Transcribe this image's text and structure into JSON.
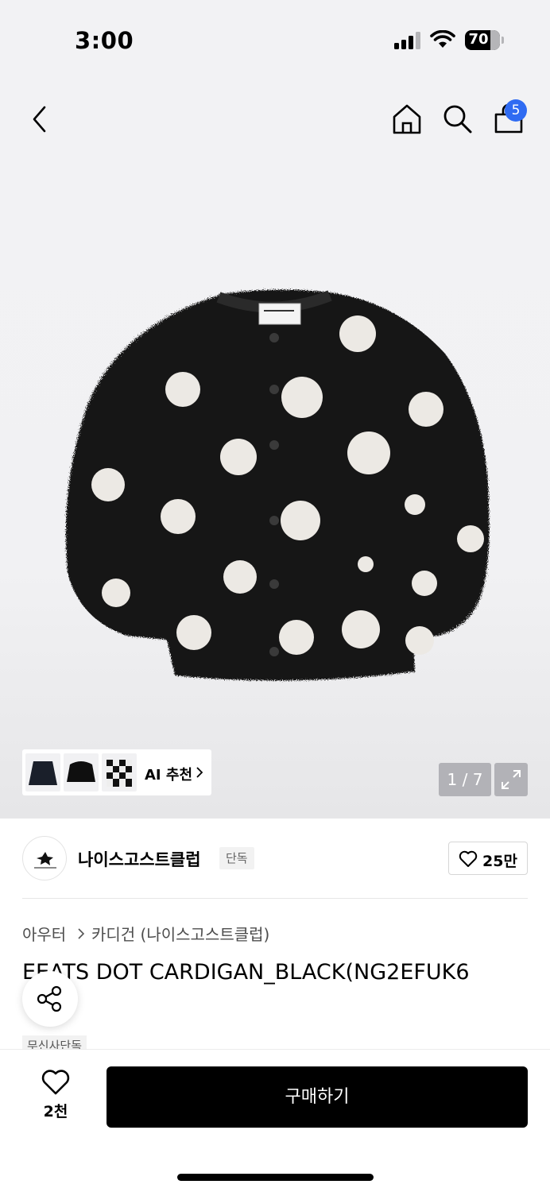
{
  "status_bar": {
    "time": "3:00",
    "battery": "70"
  },
  "nav": {
    "cart_count": "5"
  },
  "gallery": {
    "ai_label": "AI 추천",
    "counter": "1 / 7"
  },
  "brand": {
    "name": "나이스고스트클럽",
    "tag": "단독",
    "likes": "25만"
  },
  "breadcrumb": [
    "아우터",
    "카디건 (나이스고스트클럽)"
  ],
  "product": {
    "title": "EEATS DOT CARDIGAN_BLACK(NG2EFUK6",
    "tag": "무신사단독"
  },
  "bottom_bar": {
    "wish_count": "2천",
    "buy_label": "구매하기"
  }
}
